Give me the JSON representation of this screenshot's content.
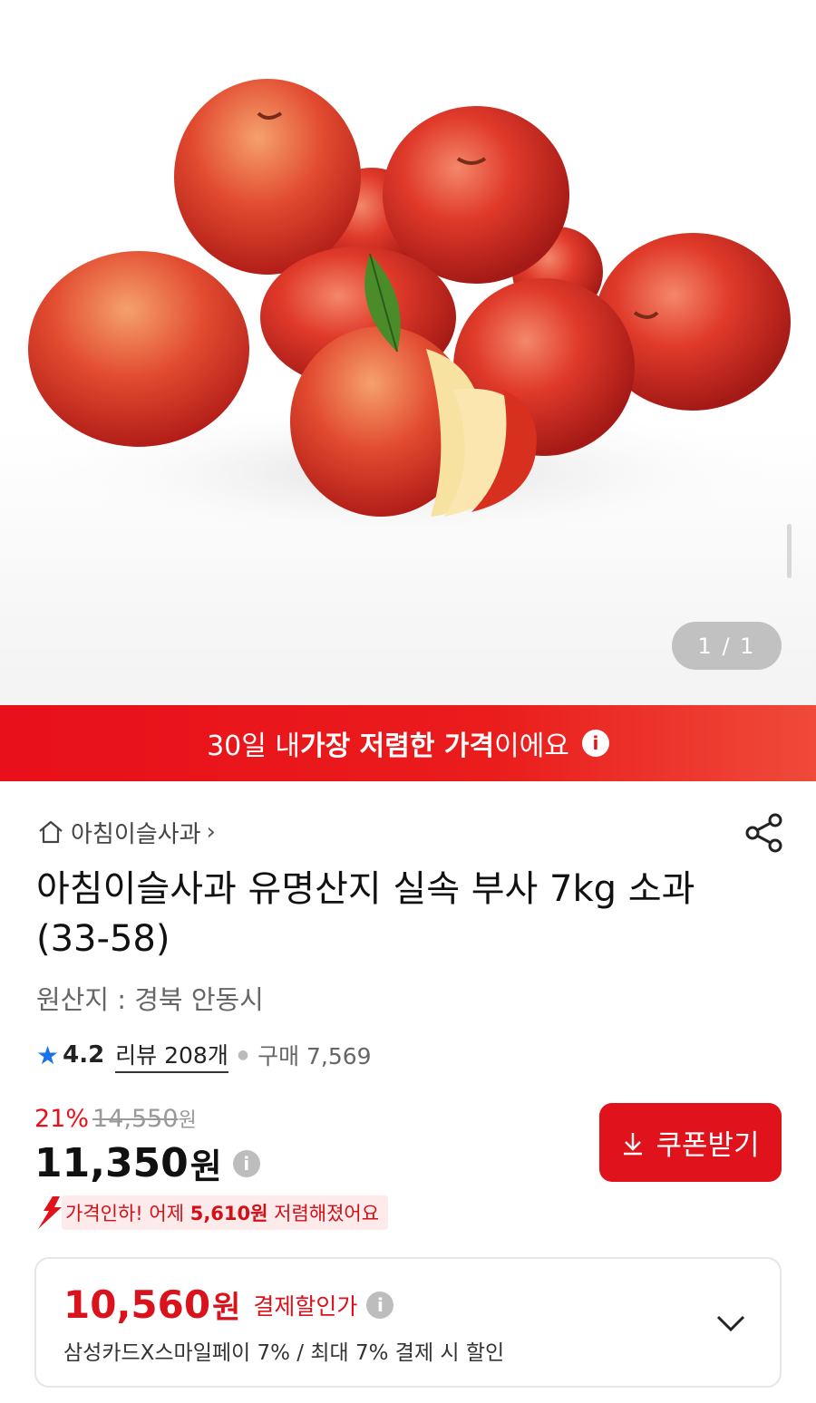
{
  "gallery": {
    "image_alt": "apples",
    "pager": "1 / 1"
  },
  "banner": {
    "pre": "30일 내 ",
    "bold": "가장 저렴한 가격",
    "post": "이에요",
    "info_icon": "info-icon"
  },
  "store": {
    "name": "아침이슬사과",
    "chevron": "›"
  },
  "product": {
    "title": "아침이슬사과 유명산지 실속 부사 7kg 소과(33-58)",
    "origin": "원산지 : 경북 안동시"
  },
  "rating": {
    "score": "4.2",
    "review": "리뷰 208개",
    "purchase": "구매 7,569",
    "star_color": "#1a73e8"
  },
  "price": {
    "discount_pct": "21%",
    "original": "14,550",
    "original_unit": "원",
    "current": "11,350",
    "current_unit": "원",
    "coupon_button": "쿠폰받기"
  },
  "price_drop": {
    "pre": "가격인하! 어제 ",
    "amount": "5,610원",
    "post": " 저렴해졌어요"
  },
  "payment": {
    "amount": "10,560",
    "unit": "원",
    "label": "결제할인가",
    "detail": "삼성카드X스마일페이 7% / 최대 7% 결제 시 할인"
  },
  "colors": {
    "accent": "#e0121b",
    "banner": "#e8101a"
  }
}
